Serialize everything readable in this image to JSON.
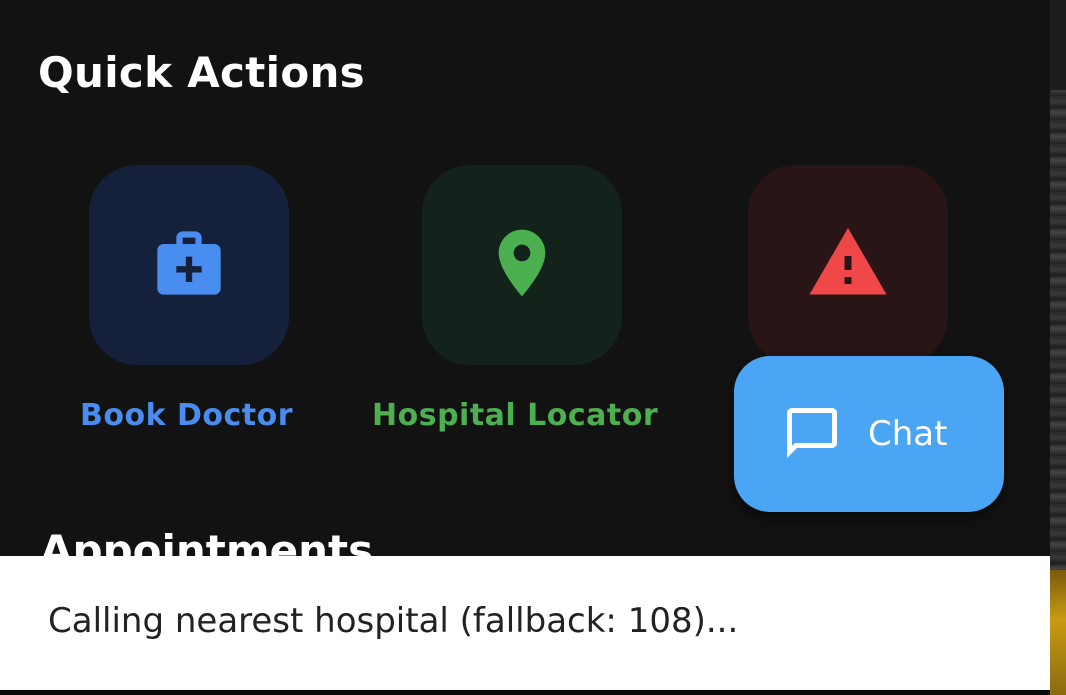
{
  "quick_actions": {
    "title": "Quick Actions",
    "items": [
      {
        "label": "Book Doctor",
        "icon": "medical-bag-icon",
        "color": "#4a8df0"
      },
      {
        "label": "Hospital Locator",
        "icon": "location-pin-icon",
        "color": "#4caf50"
      },
      {
        "label": "",
        "icon": "warning-icon",
        "color": "#f04848"
      }
    ]
  },
  "appointments": {
    "title": "Appointments"
  },
  "chat_fab": {
    "label": "Chat",
    "icon": "chat-bubble-icon",
    "color": "#4aa5f5"
  },
  "snackbar": {
    "message": "Calling nearest hospital (fallback: 108)..."
  }
}
